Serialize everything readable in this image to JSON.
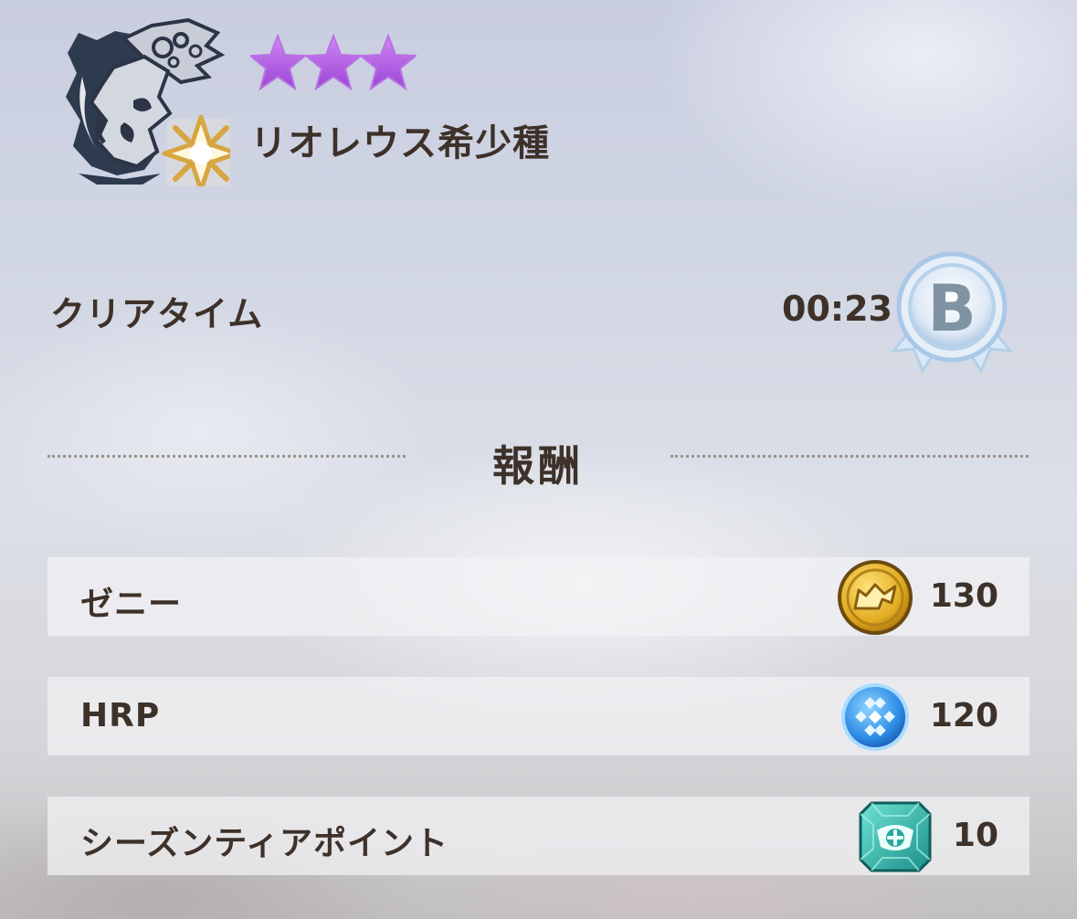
{
  "monster": {
    "name": "リオレウス希少種",
    "star_rating": 3,
    "star_color": "#b266e0",
    "icon": "rathalos-silver-icon",
    "badge_icon": "sparkle-badge-icon"
  },
  "clear_time": {
    "label": "クリアタイム",
    "value": "00:23",
    "rank": "B",
    "rank_icon": "rank-medal-icon"
  },
  "rewards": {
    "heading": "報酬",
    "items": [
      {
        "label": "ゼニー",
        "value": "130",
        "icon": "zenny-coin-icon"
      },
      {
        "label": "HRP",
        "value": "120",
        "icon": "hrp-orb-icon"
      },
      {
        "label": "シーズンティアポイント",
        "value": "10",
        "icon": "season-tier-gem-icon"
      }
    ]
  }
}
